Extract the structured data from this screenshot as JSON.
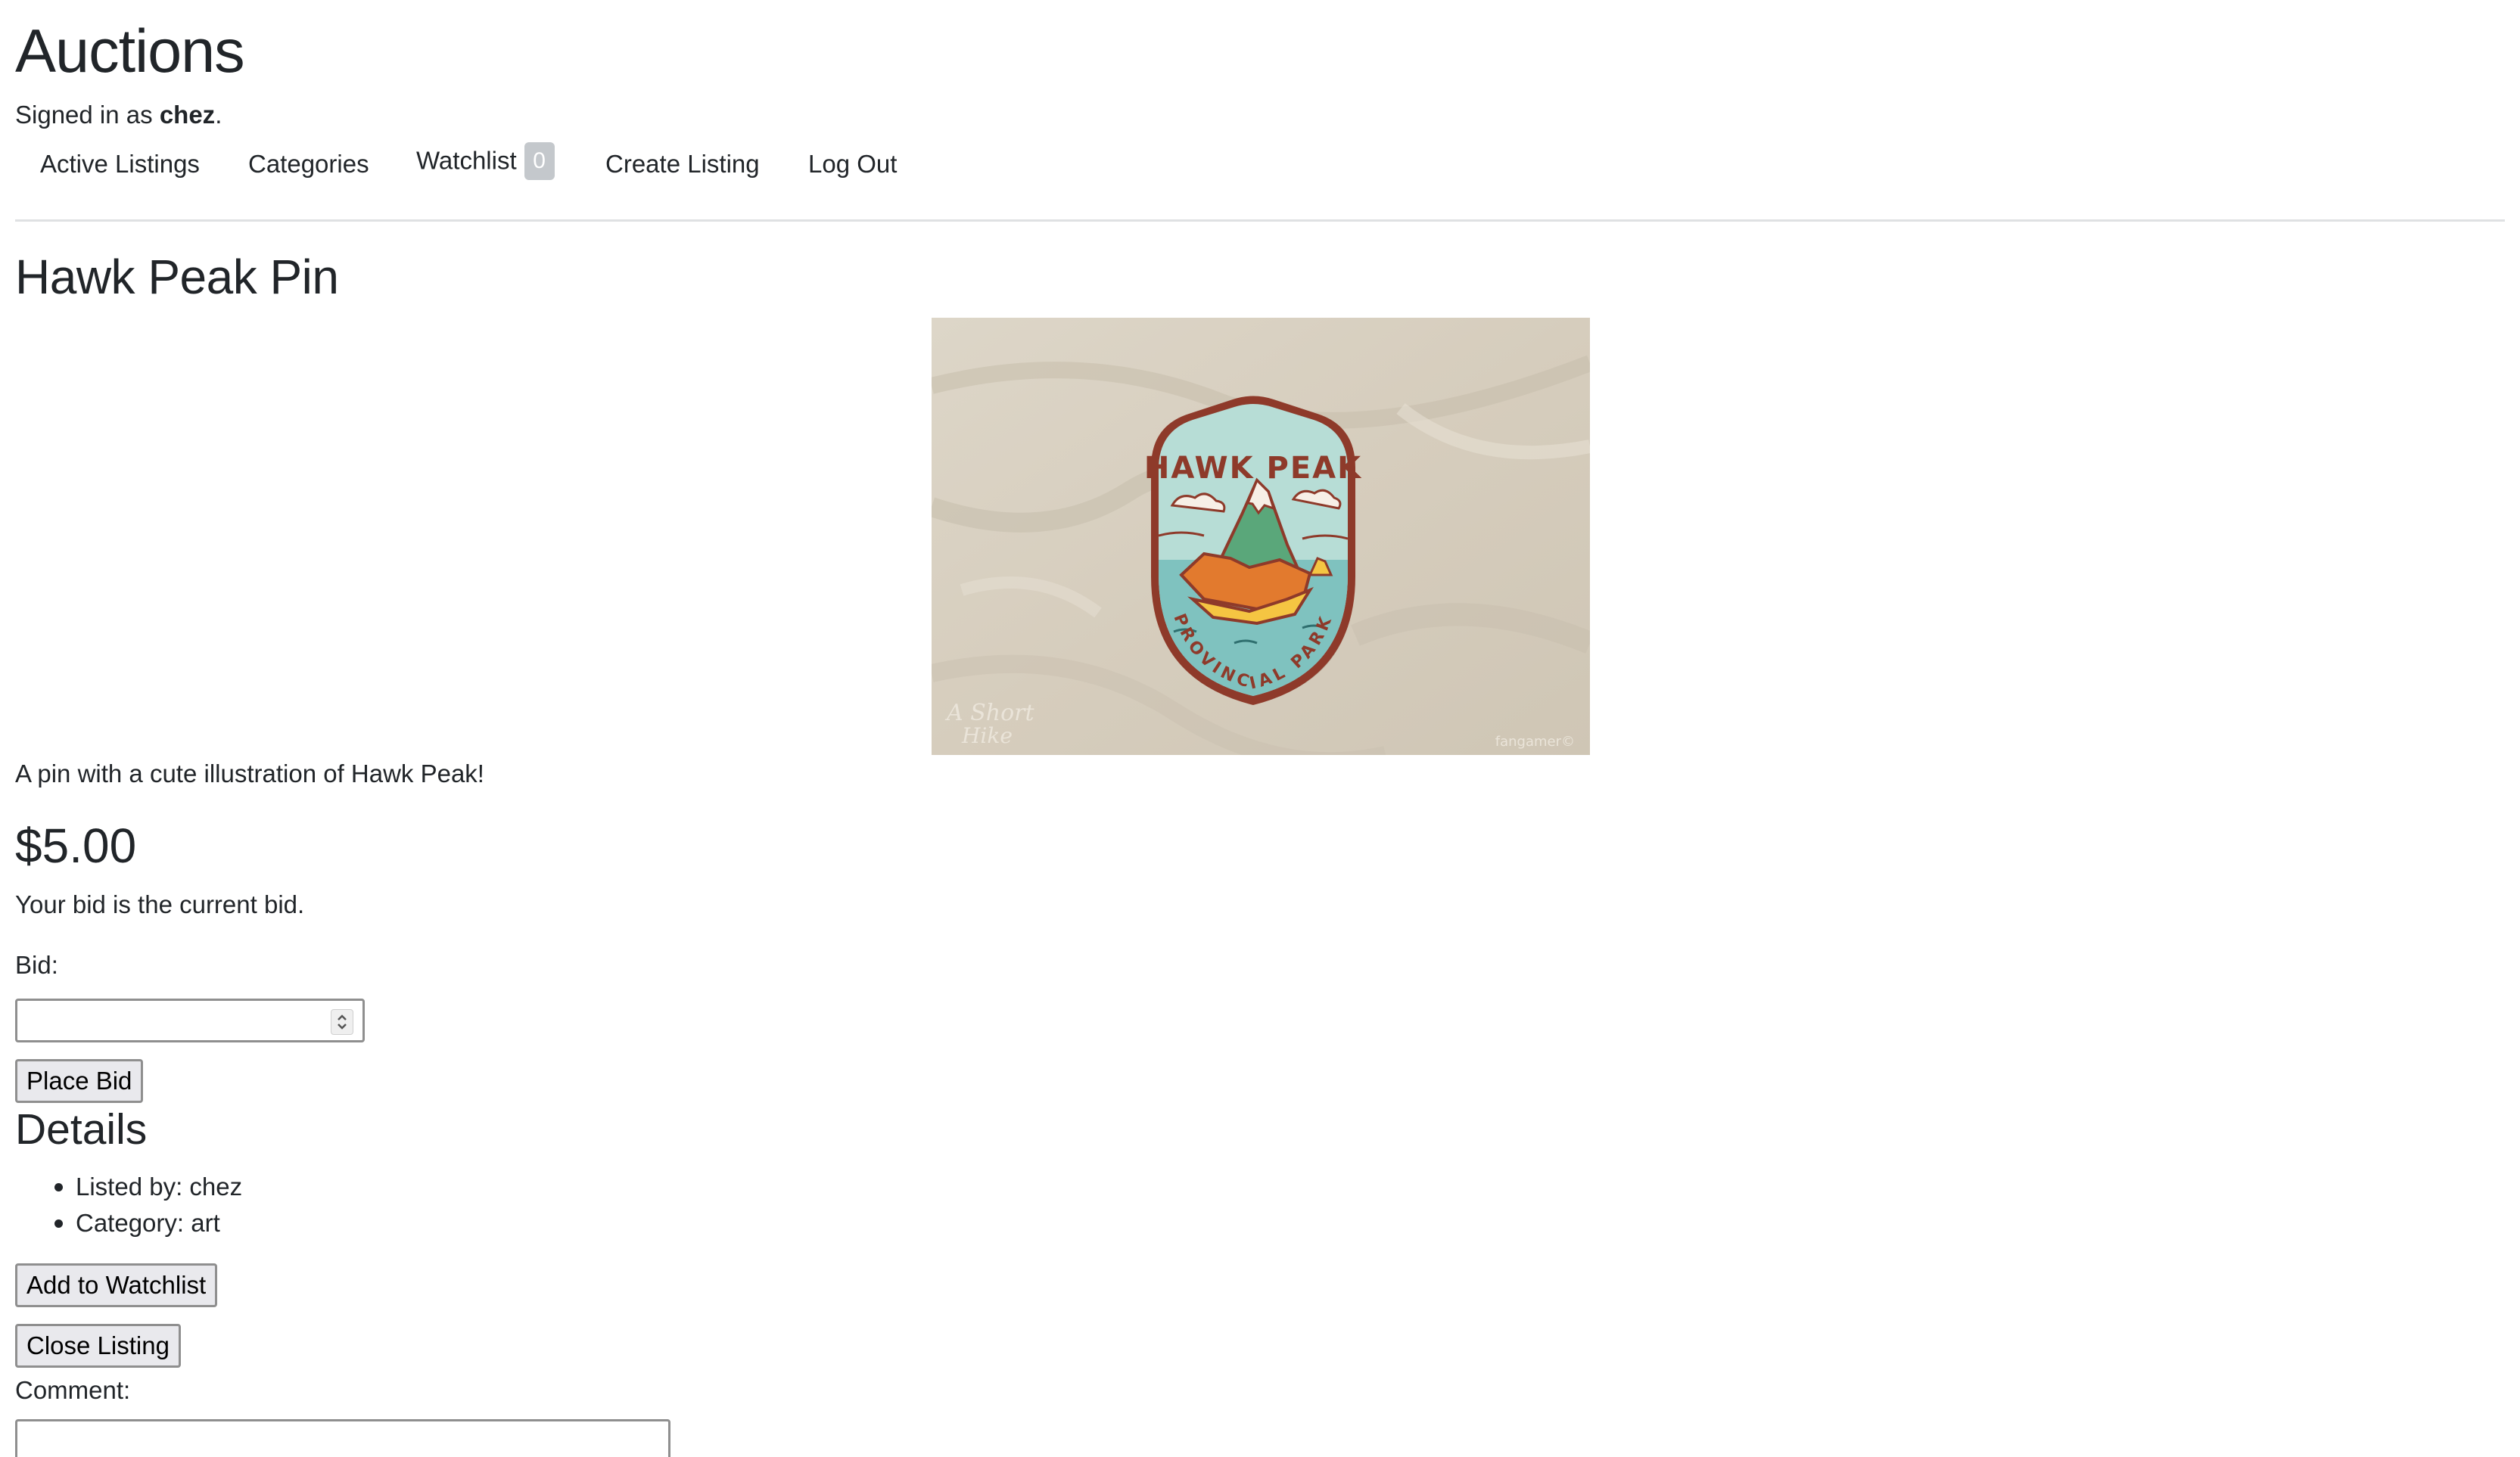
{
  "site": {
    "title": "Auctions",
    "signed_in_prefix": "Signed in as ",
    "username": "chez",
    "signed_in_suffix": "."
  },
  "nav": {
    "active_listings": "Active Listings",
    "categories": "Categories",
    "watchlist": "Watchlist",
    "watchlist_count": "0",
    "create_listing": "Create Listing",
    "log_out": "Log Out"
  },
  "listing": {
    "title": "Hawk Peak Pin",
    "image": {
      "top_text": "HAWK PEAK",
      "bottom_text": "PROVINCIAL PARK",
      "watermark_left": "A Short Hike",
      "watermark_right": "fangamer",
      "colors": {
        "fabric": "#d9d1c2",
        "pin_border": "#8e3a2a",
        "sky": "#b7ddd6",
        "water": "#7fc2bf",
        "mountain_green": "#5aa77a",
        "cliff_orange": "#e27a2e",
        "cliff_yellow": "#f5c542",
        "snow": "#f7efe6"
      }
    },
    "description": "A pin with a cute illustration of Hawk Peak!",
    "price": "$5.00",
    "bid_status": "Your bid is the current bid.",
    "bid_label": "Bid:",
    "bid_value": "",
    "place_bid": "Place Bid",
    "details_heading": "Details",
    "details": [
      {
        "text": "Listed by: chez"
      },
      {
        "text": "Category: art"
      }
    ],
    "add_to_watchlist": "Add to Watchlist",
    "close_listing": "Close Listing",
    "comment_label": "Comment:",
    "comment_value": ""
  }
}
